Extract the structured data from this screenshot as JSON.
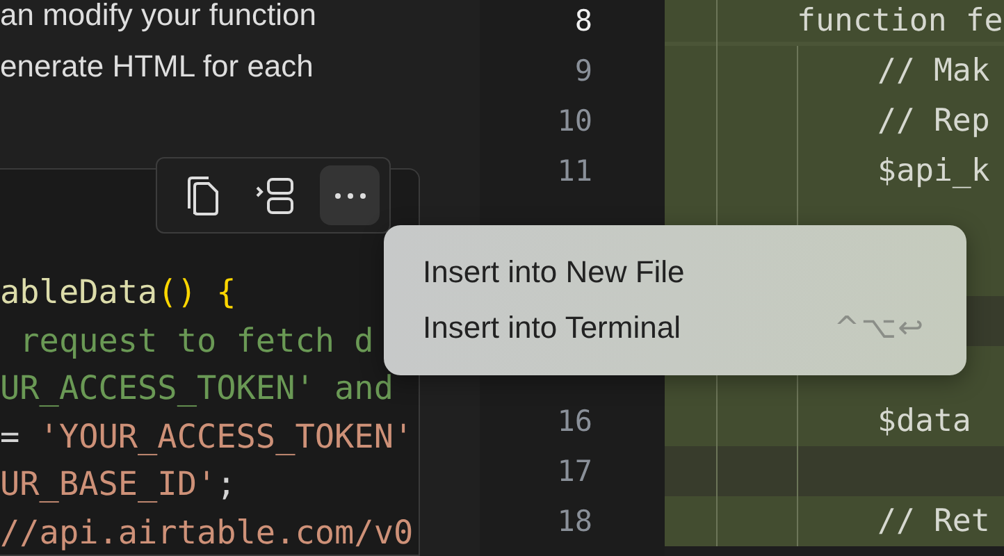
{
  "chat": {
    "lines": [
      "an modify your function",
      "enerate HTML for each"
    ]
  },
  "code_toolbar": [
    {
      "kind": "copy",
      "selected": false
    },
    {
      "kind": "apply",
      "selected": false
    },
    {
      "kind": "more",
      "selected": true
    }
  ],
  "code_block": [
    [
      {
        "kind": "fn",
        "text": "ableData"
      },
      {
        "kind": "punct",
        "text": "() {"
      }
    ],
    [
      {
        "kind": "comment",
        "text": " request to fetch d"
      }
    ],
    [
      {
        "kind": "comment",
        "text": "UR_ACCESS_TOKEN' and"
      }
    ],
    [
      {
        "kind": "plain",
        "text": "= "
      },
      {
        "kind": "string",
        "text": "'YOUR_ACCESS_TOKEN'"
      }
    ],
    [
      {
        "kind": "string",
        "text": "UR_BASE_ID'"
      },
      {
        "kind": "plain",
        "text": ";"
      }
    ],
    [
      {
        "kind": "string",
        "text": "//api.airtable.com/v0"
      }
    ]
  ],
  "editor": {
    "lines": [
      {
        "number": "8",
        "text": "function fe",
        "current": true,
        "color": "#434d30",
        "children": [
          {
            "number": "9",
            "text": "// Mak",
            "current": false,
            "color": "#434d30"
          },
          {
            "number": "10",
            "text": "// Rep",
            "current": false,
            "color": "#434d30"
          },
          {
            "number": "11",
            "text": "$api_k",
            "current": false,
            "color": "#434d30"
          },
          {
            "color": "#434d30"
          },
          {
            "color": "#434d30"
          },
          {
            "color": "#383c2c"
          },
          {
            "color": "#434d30"
          },
          {
            "number": "16",
            "text": "$data",
            "current": false,
            "color": "#434d30"
          },
          {
            "number": "17",
            "current": false,
            "color": "#383c2c"
          },
          {
            "number": "18",
            "text": "// Ret",
            "current": false,
            "color": "#434d30"
          }
        ]
      }
    ]
  },
  "menu": {
    "items": [
      {
        "label": "Insert into New File"
      },
      {
        "label": "Insert into Terminal",
        "shortcut": "^⌥↩"
      }
    ]
  }
}
